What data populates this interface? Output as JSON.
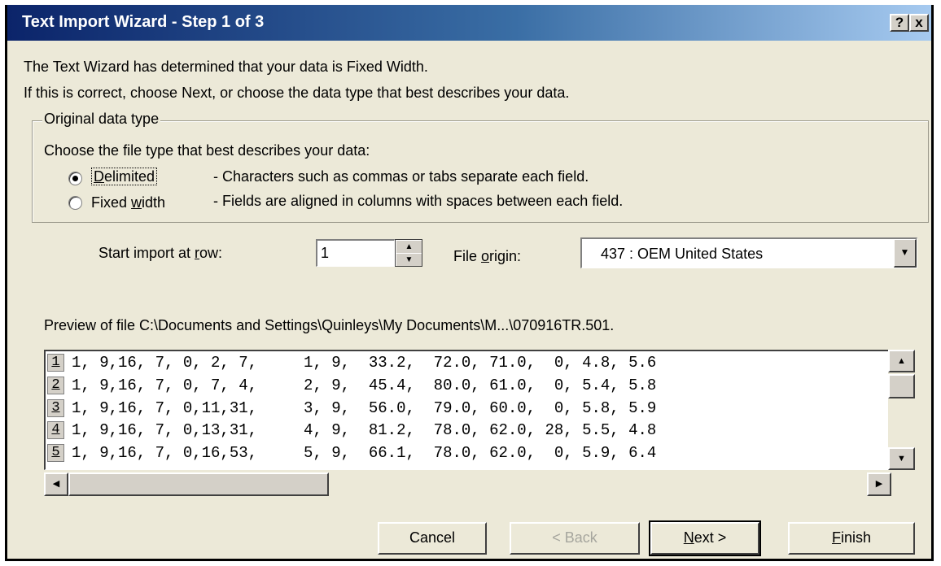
{
  "window": {
    "title": "Text Import Wizard - Step 1 of 3",
    "help_label": "?",
    "close_label": "x"
  },
  "intro": {
    "line1": "The Text Wizard has determined that your data is Fixed Width.",
    "line2": "If this is correct, choose Next, or choose the data type that best describes your data."
  },
  "data_type": {
    "group_title": "Original data type",
    "prompt": "Choose the file type that best describes your data:",
    "options": [
      {
        "label_pre": "",
        "label_key": "D",
        "label_post": "elimited",
        "description": "- Characters such as commas or tabs separate each field.",
        "selected": true
      },
      {
        "label_pre": "Fixed ",
        "label_key": "w",
        "label_post": "idth",
        "description": "- Fields are aligned in columns with spaces between each field.",
        "selected": false
      }
    ]
  },
  "start_row": {
    "label_pre": "Start import at ",
    "label_key": "r",
    "label_post": "ow:",
    "value": "1"
  },
  "file_origin": {
    "label_pre": "File ",
    "label_key": "o",
    "label_post": "rigin:",
    "value": "437 : OEM United States"
  },
  "preview": {
    "label": "Preview of file C:\\Documents and Settings\\Quinleys\\My Documents\\M...\\070916TR.501.",
    "rows": [
      {
        "num": "1",
        "text": "1, 9,16, 7, 0, 2, 7,     1, 9,  33.2,  72.0, 71.0,  0, 4.8, 5.6"
      },
      {
        "num": "2",
        "text": "1, 9,16, 7, 0, 7, 4,     2, 9,  45.4,  80.0, 61.0,  0, 5.4, 5.8"
      },
      {
        "num": "3",
        "text": "1, 9,16, 7, 0,11,31,     3, 9,  56.0,  79.0, 60.0,  0, 5.8, 5.9"
      },
      {
        "num": "4",
        "text": "1, 9,16, 7, 0,13,31,     4, 9,  81.2,  78.0, 62.0, 28, 5.5, 4.8"
      },
      {
        "num": "5",
        "text": "1, 9,16, 7, 0,16,53,     5, 9,  66.1,  78.0, 62.0,  0, 5.9, 6.4"
      }
    ]
  },
  "buttons": {
    "cancel": "Cancel",
    "back": "< Back",
    "next_key": "N",
    "next_post": "ext >",
    "finish_key": "F",
    "finish_post": "inish"
  }
}
